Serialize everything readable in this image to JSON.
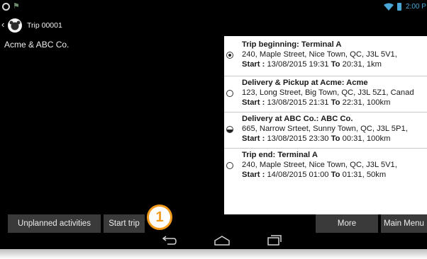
{
  "status_bar": {
    "clock": "2:00 P",
    "icons": [
      "circle-notification-icon",
      "flag-icon",
      "wifi-icon",
      "battery-icon"
    ]
  },
  "action_bar": {
    "title": "Trip 00001",
    "icons": [
      "back-caret-icon",
      "app-logo-icon"
    ]
  },
  "client": "Acme & ABC Co.",
  "trips": [
    {
      "heading": "Trip beginning:  Terminal A",
      "address": "240, Maple Street, Nice Town, QC, J3L 5V1,",
      "start_label": "Start :",
      "start_value": "13/08/2015 19:31",
      "to_label": "To",
      "to_value": "20:31, 1km",
      "radio_state": "selected"
    },
    {
      "heading": "Delivery & Pickup at Acme:  Acme",
      "address": "123, Long Street, Big Town, QC, J3L 5Z1, Canad",
      "start_label": "Start :",
      "start_value": "13/08/2015 21:31",
      "to_label": "To",
      "to_value": "22:31, 100km",
      "radio_state": "unselected"
    },
    {
      "heading": "Delivery at ABC Co.:  ABC Co.",
      "address": "665, Narrow Srteet, Sunny Town, QC, J3L 5P1,",
      "start_label": "Start :",
      "start_value": "13/08/2015 23:30",
      "to_label": "To",
      "to_value": "00:31, 100km",
      "radio_state": "partial"
    },
    {
      "heading": "Trip end:  Terminal A",
      "address": "240, Maple Street, Nice Town, QC, J3L 5V1,",
      "start_label": "Start :",
      "start_value": "14/08/2015 01:00",
      "to_label": "To",
      "to_value": "01:31, 50km",
      "radio_state": "unselected"
    }
  ],
  "buttons": {
    "unplanned": "Unplanned activities",
    "start_trip": "Start trip",
    "more": "More",
    "main_menu": "Main Menu"
  },
  "callout": "1",
  "nav_icons": [
    "back-icon",
    "home-icon",
    "recent-apps-icon"
  ],
  "colors": {
    "accent_orange": "#f29a1b",
    "status_blue": "#4aa6d6",
    "button_gray": "#3a3a3a"
  }
}
